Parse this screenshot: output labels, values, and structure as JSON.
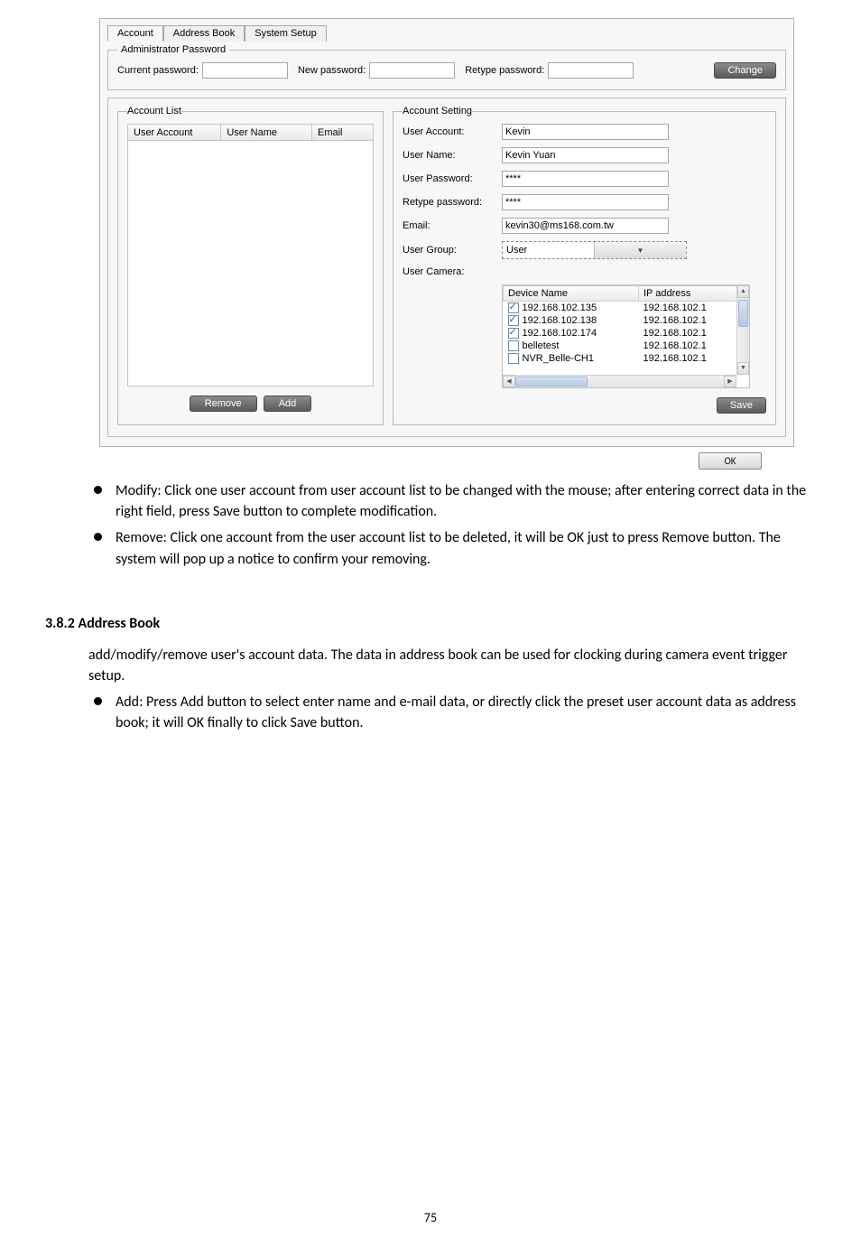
{
  "tabs": {
    "account": "Account",
    "address_book": "Address Book",
    "system_setup": "System Setup"
  },
  "admin_pwd": {
    "legend": "Administrator Password",
    "current_label": "Current password:",
    "new_label": "New password:",
    "retype_label": "Retype password:",
    "change_btn": "Change"
  },
  "account_list": {
    "legend": "Account List",
    "col_user_account": "User Account",
    "col_user_name": "User Name",
    "col_email": "Email",
    "remove_btn": "Remove",
    "add_btn": "Add"
  },
  "account_setting": {
    "legend": "Account Setting",
    "user_account_label": "User Account:",
    "user_account_value": "Kevin",
    "user_name_label": "User Name:",
    "user_name_value": "Kevin Yuan",
    "user_password_label": "User Password:",
    "user_password_value": "****",
    "retype_label": "Retype password:",
    "retype_value": "****",
    "email_label": "Email:",
    "email_value": "kevin30@ms168.com.tw",
    "user_group_label": "User Group:",
    "user_group_value": "User",
    "user_camera_label": "User Camera:",
    "col_device_name": "Device Name",
    "col_ip_address": "IP address",
    "devices": [
      {
        "checked": true,
        "name": "192.168.102.135",
        "ip": "192.168.102.1"
      },
      {
        "checked": true,
        "name": "192.168.102.138",
        "ip": "192.168.102.1"
      },
      {
        "checked": true,
        "name": "192.168.102.174",
        "ip": "192.168.102.1"
      },
      {
        "checked": false,
        "name": "belletest",
        "ip": "192.168.102.1"
      },
      {
        "checked": false,
        "name": "NVR_Belle-CH1",
        "ip": "192.168.102.1"
      }
    ],
    "save_btn": "Save"
  },
  "ok_btn": "OK",
  "bullets": {
    "modify": "Modify: Click one user account from user account list to be changed with the mouse; after entering correct data in the right field, press Save button to complete modification.",
    "remove": "Remove: Click one account from the user account list to be deleted, it will be OK just to press Remove button. The system will pop up a notice to confirm your removing.",
    "add": "Add: Press Add button to select enter name and e-mail data, or directly click the preset user account data as address book; it will OK finally to click Save button."
  },
  "section_heading": "3.8.2 Address Book",
  "section_intro": "add/modify/remove user's account data. The data in address book can be used for clocking during camera event trigger setup.",
  "page_number": "75"
}
